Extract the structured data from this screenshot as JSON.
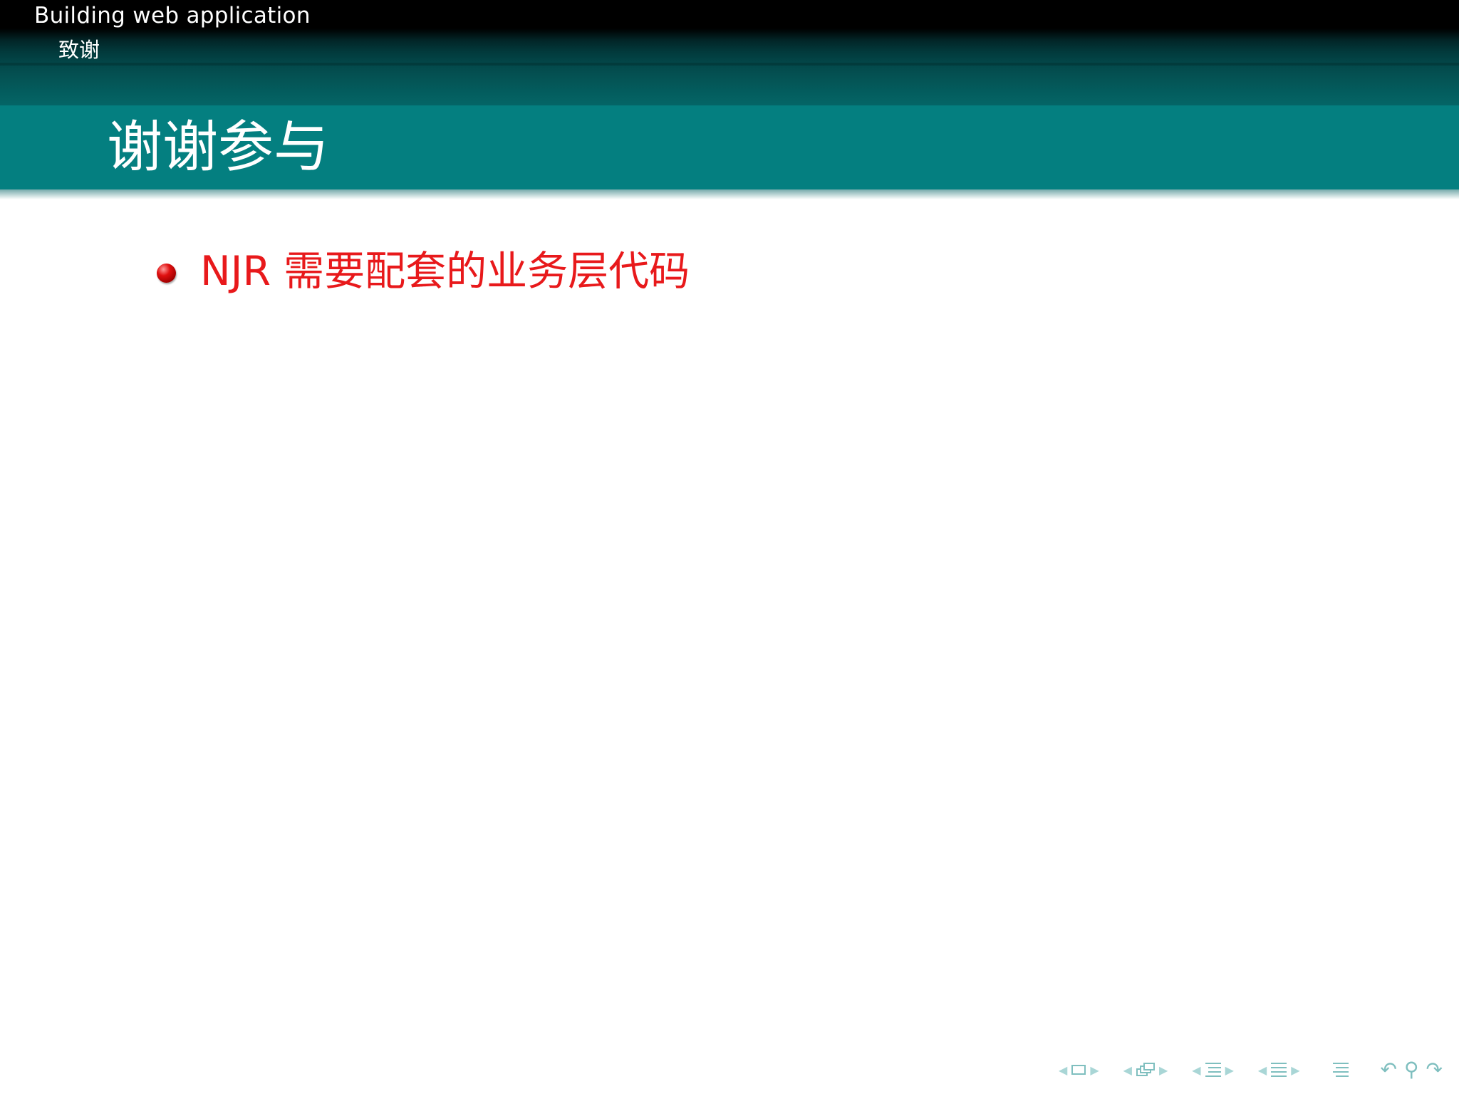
{
  "header": {
    "doc_title": "Building web application",
    "section_name": "致谢"
  },
  "frame": {
    "title": "谢谢参与"
  },
  "bullets": [
    {
      "text": "NJR 需要配套的业务层代码"
    }
  ],
  "colors": {
    "header_black": "#000000",
    "header_teal": "#046566",
    "title_bar": "#047f80",
    "bullet_text": "#e8191b",
    "nav_icons": "#7fbfbf"
  },
  "nav": {
    "icons": [
      "prev-frame-arrow-icon",
      "frame-icon",
      "next-frame-arrow-icon",
      "prev-slide-arrow-icon",
      "slide-stack-icon",
      "next-slide-arrow-icon",
      "prev-subsection-arrow-icon",
      "subsection-icon",
      "next-subsection-arrow-icon",
      "prev-section-arrow-icon",
      "section-icon",
      "next-section-arrow-icon",
      "document-icon",
      "back-icon",
      "search-icon",
      "forward-icon"
    ]
  }
}
